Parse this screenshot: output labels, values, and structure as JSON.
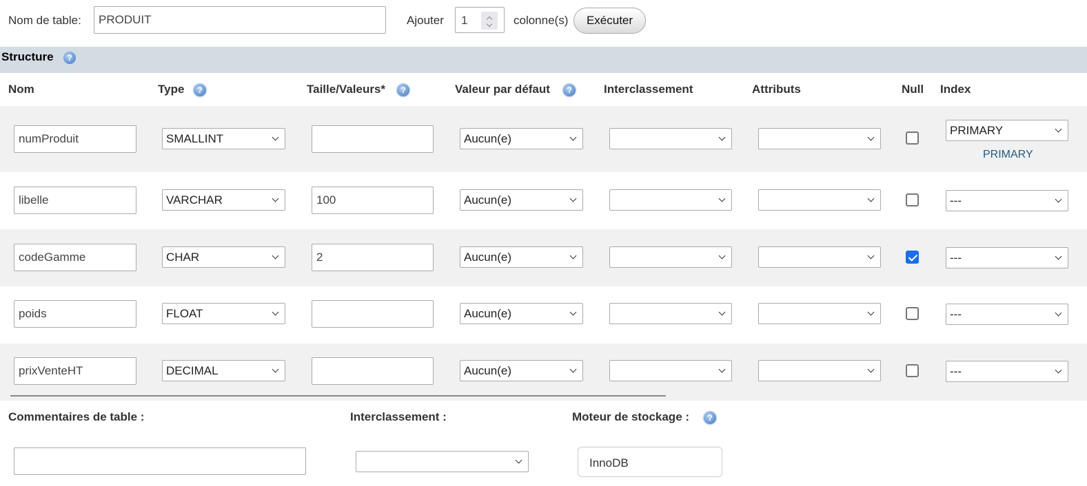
{
  "top": {
    "table_name_label": "Nom de table:",
    "table_name_value": "PRODUIT",
    "add_label": "Ajouter",
    "add_count": "1",
    "columns_label": "colonne(s)",
    "execute_label": "Exécuter"
  },
  "structure": {
    "title": "Structure",
    "help_glyph": "?"
  },
  "headers": {
    "name": "Nom",
    "type": "Type",
    "length": "Taille/Valeurs*",
    "default": "Valeur par défaut",
    "collation": "Interclassement",
    "attributes": "Attributs",
    "null": "Null",
    "index": "Index"
  },
  "rows": [
    {
      "name": "numProduit",
      "type": "SMALLINT",
      "length": "",
      "default": "Aucun(e)",
      "collation": "",
      "attributes": "",
      "null": false,
      "index": "PRIMARY",
      "index_link": "PRIMARY"
    },
    {
      "name": "libelle",
      "type": "VARCHAR",
      "length": "100",
      "default": "Aucun(e)",
      "collation": "",
      "attributes": "",
      "null": false,
      "index": "---"
    },
    {
      "name": "codeGamme",
      "type": "CHAR",
      "length": "2",
      "default": "Aucun(e)",
      "collation": "",
      "attributes": "",
      "null": true,
      "index": "---"
    },
    {
      "name": "poids",
      "type": "FLOAT",
      "length": "",
      "default": "Aucun(e)",
      "collation": "",
      "attributes": "",
      "null": false,
      "index": "---"
    },
    {
      "name": "prixVenteHT",
      "type": "DECIMAL",
      "length": "",
      "default": "Aucun(e)",
      "collation": "",
      "attributes": "",
      "null": false,
      "index": "---"
    }
  ],
  "bottom": {
    "comments_label": "Commentaires de table :",
    "comments_value": "",
    "collation_label": "Interclassement :",
    "collation_value": "",
    "engine_label": "Moteur de stockage :",
    "engine_value": "InnoDB"
  },
  "colors": {
    "structure_bar": "#d3dbe3",
    "row_alt": "#f1f1f1",
    "checkbox_checked": "#1a6ee8",
    "link": "#235a81"
  }
}
